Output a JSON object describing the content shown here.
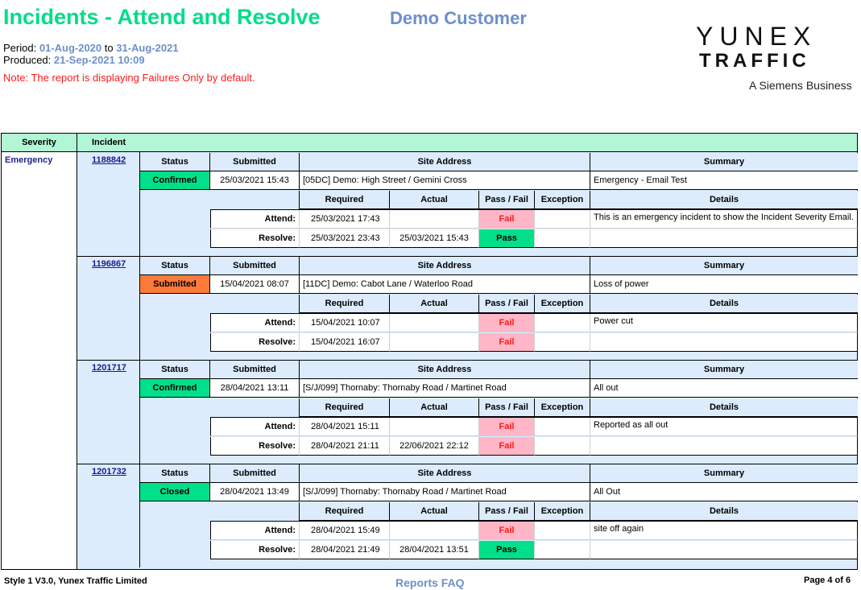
{
  "header": {
    "title": "Incidents - Attend and Resolve",
    "customer": "Demo Customer",
    "period_label": "Period:",
    "period_from": "01-Aug-2020",
    "period_to_label": "to",
    "period_to": "31-Aug-2021",
    "produced_label": "Produced:",
    "produced": "21-Sep-2021 10:09",
    "note": "Note: The report is displaying Failures Only by default."
  },
  "logo": {
    "line1": "YUNEX",
    "line2": "TRAFFIC",
    "line3": "A Siemens Business"
  },
  "table": {
    "col_severity": "Severity",
    "col_incident": "Incident",
    "severity": "Emergency",
    "sub_headers": {
      "status": "Status",
      "submitted": "Submitted",
      "site_address": "Site Address",
      "summary": "Summary",
      "required": "Required",
      "actual": "Actual",
      "pass_fail": "Pass / Fail",
      "exception": "Exception",
      "details": "Details",
      "attend": "Attend:",
      "resolve": "Resolve:"
    },
    "incidents": [
      {
        "id": "1188842",
        "status": "Confirmed",
        "status_color": "#00e08a",
        "submitted": "25/03/2021 15:43",
        "site_address": "[05DC] Demo: High Street / Gemini Cross",
        "summary": "Emergency - Email Test",
        "attend": {
          "required": "25/03/2021 17:43",
          "actual": "",
          "result": "Fail",
          "exception": ""
        },
        "resolve": {
          "required": "25/03/2021 23:43",
          "actual": "25/03/2021 15:43",
          "result": "Pass",
          "exception": ""
        },
        "details": "This is an emergency incident to show the Incident Severity Email."
      },
      {
        "id": "1196867",
        "status": "Submitted",
        "status_color": "#fb7a3a",
        "submitted": "15/04/2021 08:07",
        "site_address": "[11DC] Demo: Cabot Lane / Waterloo Road",
        "summary": "Loss of power",
        "attend": {
          "required": "15/04/2021 10:07",
          "actual": "",
          "result": "Fail",
          "exception": ""
        },
        "resolve": {
          "required": "15/04/2021 16:07",
          "actual": "",
          "result": "Fail",
          "exception": ""
        },
        "details": "Power cut"
      },
      {
        "id": "1201717",
        "status": "Confirmed",
        "status_color": "#00e08a",
        "submitted": "28/04/2021 13:11",
        "site_address": "[S/J/099] Thornaby: Thornaby Road / Martinet Road",
        "summary": "All out",
        "attend": {
          "required": "28/04/2021 15:11",
          "actual": "",
          "result": "Fail",
          "exception": ""
        },
        "resolve": {
          "required": "28/04/2021 21:11",
          "actual": "22/06/2021 22:12",
          "result": "Fail",
          "exception": ""
        },
        "details": "Reported as all out"
      },
      {
        "id": "1201732",
        "status": "Closed",
        "status_color": "#00e08a",
        "submitted": "28/04/2021 13:49",
        "site_address": "[S/J/099] Thornaby: Thornaby Road / Martinet Road",
        "summary": "All Out",
        "attend": {
          "required": "28/04/2021 15:49",
          "actual": "",
          "result": "Fail",
          "exception": ""
        },
        "resolve": {
          "required": "28/04/2021 21:49",
          "actual": "28/04/2021 13:51",
          "result": "Pass",
          "exception": ""
        },
        "details": "site off again"
      }
    ]
  },
  "footer": {
    "left": "Style 1 V3.0, Yunex Traffic Limited",
    "faq_link": "Reports FAQ",
    "page": "Page 4 of 6"
  }
}
